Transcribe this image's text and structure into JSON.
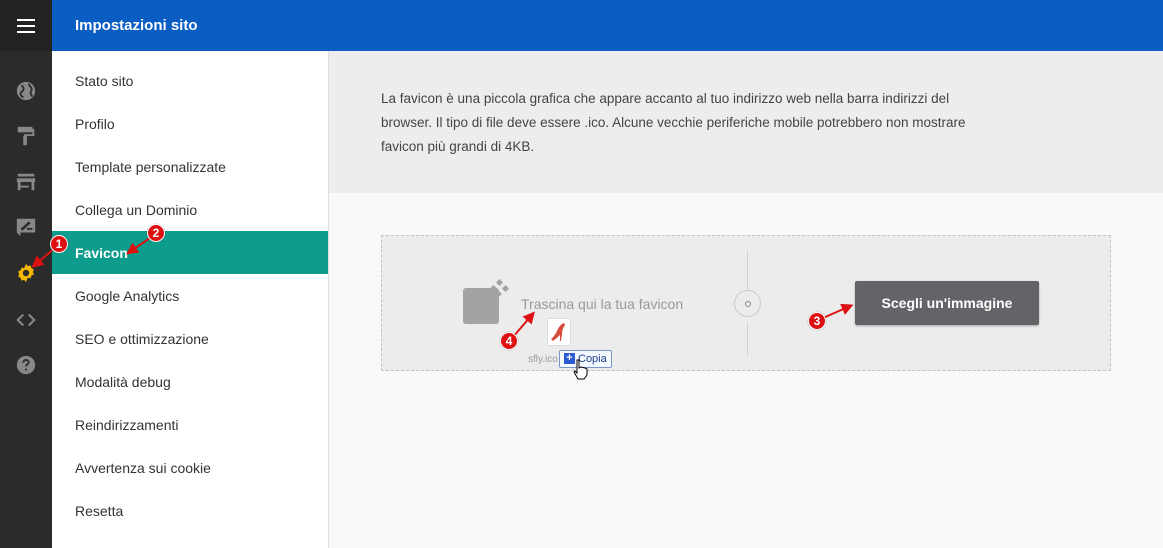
{
  "header": {
    "title": "Impostazioni sito"
  },
  "rail": {
    "menu_icon": "hamburger-icon",
    "items": [
      {
        "icon": "globe-icon"
      },
      {
        "icon": "paint-roller-icon"
      },
      {
        "icon": "store-icon"
      },
      {
        "icon": "edit-box-icon"
      },
      {
        "icon": "gear-icon",
        "active_color": "#f5b800"
      },
      {
        "icon": "code-icon"
      },
      {
        "icon": "help-icon"
      }
    ]
  },
  "nav": {
    "items": [
      {
        "label": "Stato sito"
      },
      {
        "label": "Profilo"
      },
      {
        "label": "Template personalizzate"
      },
      {
        "label": "Collega un Dominio"
      },
      {
        "label": "Favicon",
        "active": true
      },
      {
        "label": "Google Analytics"
      },
      {
        "label": "SEO e ottimizzazione"
      },
      {
        "label": "Modalità debug"
      },
      {
        "label": "Reindirizzamenti"
      },
      {
        "label": "Avvertenza sui cookie"
      },
      {
        "label": "Resetta"
      }
    ]
  },
  "content": {
    "info_text": "La favicon è una piccola grafica che appare accanto al tuo indirizzo web nella barra indirizzi del browser. Il tipo di file deve essere .ico. Alcune vecchie periferiche mobile potrebbero non mostrare favicon più grandi di 4KB.",
    "dropzone": {
      "drop_text": "Trascina qui la tua favicon",
      "choose_button": "Scegli un'immagine"
    },
    "drag": {
      "filename": "sfly.ico",
      "copy_label": "Copia"
    }
  },
  "annotations": [
    "1",
    "2",
    "3",
    "4"
  ],
  "colors": {
    "header": "#0a5dc2",
    "rail": "#2b2b2b",
    "active_nav": "#0e9c8c",
    "button": "#636468",
    "annotation": "#dd1111"
  }
}
